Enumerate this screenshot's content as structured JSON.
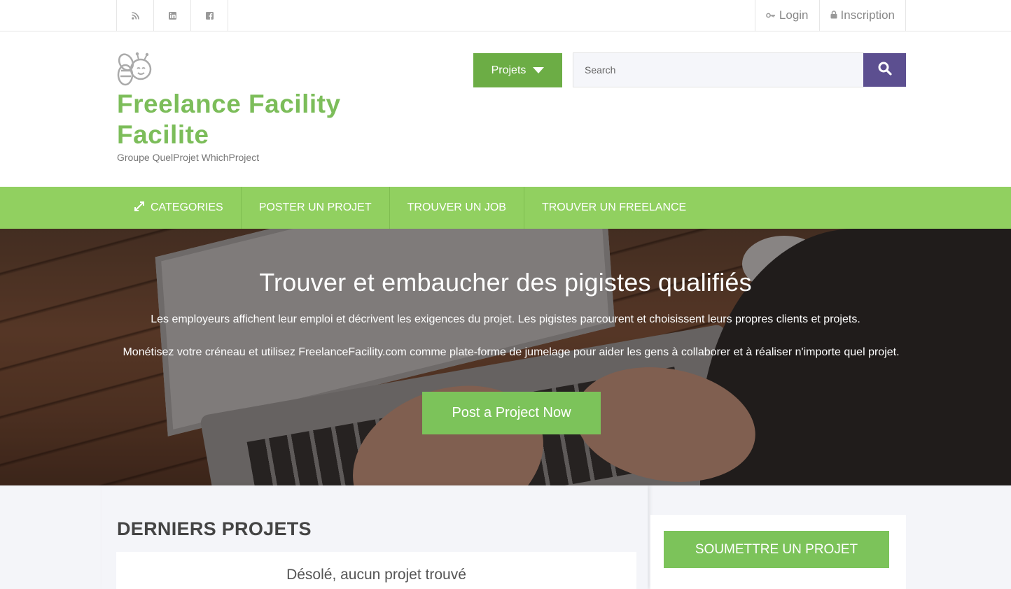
{
  "topbar": {
    "social": [
      {
        "icon": "rss-icon",
        "glyph": "◉"
      },
      {
        "icon": "linkedin-icon",
        "glyph": "in"
      },
      {
        "icon": "facebook-icon",
        "glyph": "f"
      }
    ],
    "login_label": "Login",
    "register_label": "Inscription"
  },
  "header": {
    "site_title": "Freelance Facility Facilite",
    "tagline": "Groupe QuelProjet WhichProject",
    "projets_label": "Projets",
    "search_placeholder": "Search"
  },
  "nav": {
    "items": [
      {
        "label": "CATEGORIES"
      },
      {
        "label": "POSTER UN PROJET"
      },
      {
        "label": "TROUVER UN JOB"
      },
      {
        "label": "TROUVER UN FREELANCE"
      }
    ]
  },
  "hero": {
    "title": "Trouver et embaucher des pigistes qualifiés",
    "paragraph1": "Les employeurs affichent leur emploi et décrivent les exigences du projet. Les pigistes parcourent et choisissent leurs propres clients et projets.",
    "paragraph2": "Monétisez votre créneau et utilisez FreelanceFacility.com comme plate-forme de jumelage pour aider les gens à collaborer et à réaliser n'importe quel projet.",
    "cta_label": "Post a Project Now"
  },
  "main": {
    "section_title": "DERNIERS PROJETS",
    "empty_message": "Désolé, aucun projet trouvé",
    "submit_label": "SOUMETTRE UN PROJET"
  },
  "colors": {
    "brand_green": "#7cbd5a",
    "nav_green": "#91d060",
    "search_purple": "#5c4f90"
  }
}
